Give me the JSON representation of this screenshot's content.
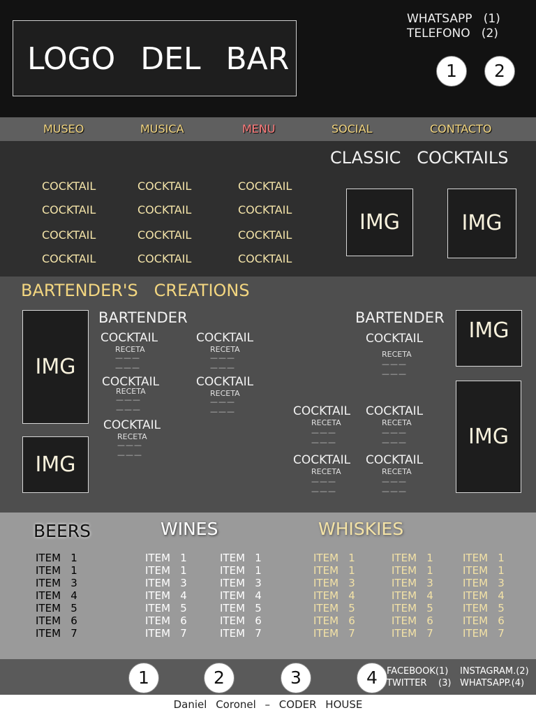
{
  "header": {
    "logo": "LOGO DEL BAR",
    "contact_whatsapp": "WHATSAPP   (1)",
    "contact_phone": "TELEFONO   (2)",
    "circle_1": "1",
    "circle_2": "2"
  },
  "nav": {
    "items": [
      "MUSEO",
      "MUSICA",
      "MENU",
      "SOCIAL",
      "CONTACTO"
    ],
    "active": "MENU"
  },
  "classic": {
    "title": "CLASSIC   COCKTAILS",
    "cocktail_label": "COCKTAIL",
    "img_label": "IMG"
  },
  "creations": {
    "title": "BARTENDER'S   CREATIONS",
    "bartender_label": "BARTENDER",
    "cocktail_label": "COCKTAIL",
    "recipe_label": "RECETA",
    "dashes": "———",
    "img_label": "IMG"
  },
  "drinks": {
    "beers": {
      "title": "BEERS",
      "items": [
        "ITEM   1",
        "ITEM   1",
        "ITEM   3",
        "ITEM   4",
        "ITEM   5",
        "ITEM   6",
        "ITEM   7"
      ]
    },
    "wines": {
      "title": "WINES",
      "items": [
        "ITEM   1",
        "ITEM   1",
        "ITEM   3",
        "ITEM   4",
        "ITEM   5",
        "ITEM   6",
        "ITEM   7"
      ]
    },
    "whiskies": {
      "title": "WHISKIES",
      "items": [
        "ITEM   1",
        "ITEM   1",
        "ITEM   3",
        "ITEM   4",
        "ITEM   5",
        "ITEM   6",
        "ITEM   7"
      ]
    }
  },
  "footer": {
    "circles": [
      "1",
      "2",
      "3",
      "4"
    ],
    "social_line1_left": "FACEBOOK(1)",
    "social_line1_right": "INSTAGRAM.(2)",
    "social_line2_left": "TWITTER    (3)",
    "social_line2_right": "WHATSAPP.(4)",
    "credit": "Daniel   Coronel   –   CODER   HOUSE"
  },
  "colors": {
    "accent_yellow": "#f3d680",
    "active_red": "#ff7b7b",
    "header_bg": "#121212"
  }
}
